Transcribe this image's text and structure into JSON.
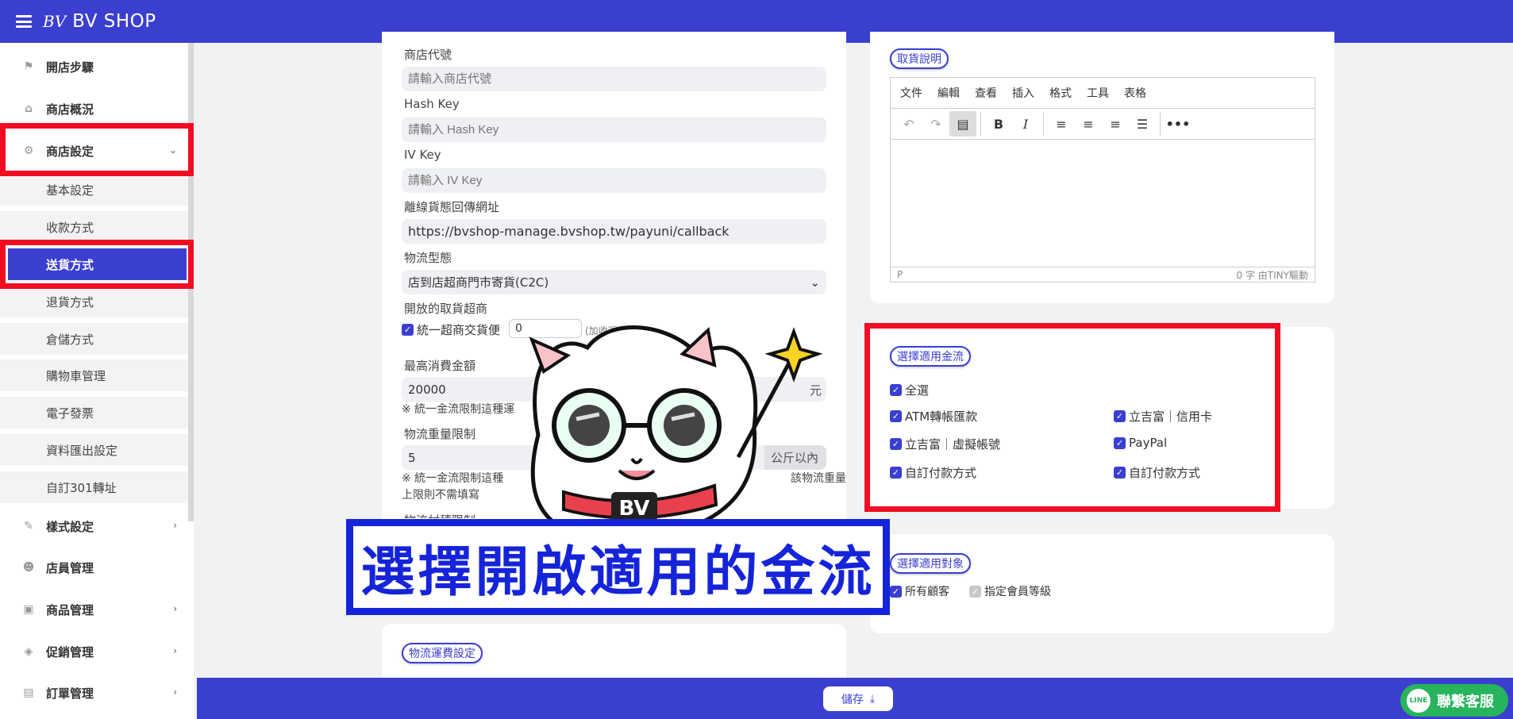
{
  "topbar": {
    "logo_mark": "BV",
    "brand": "BV SHOP"
  },
  "sidebar": {
    "items": [
      {
        "label": "開店步驟",
        "icon": "flag-icon"
      },
      {
        "label": "商店概況",
        "icon": "home-icon"
      },
      {
        "label": "商店設定",
        "icon": "gear-icon",
        "expanded": true
      },
      {
        "label": "樣式設定",
        "icon": "magic-wand-icon"
      },
      {
        "label": "店員管理",
        "icon": "users-icon"
      },
      {
        "label": "商品管理",
        "icon": "box-icon"
      },
      {
        "label": "促銷管理",
        "icon": "tags-icon"
      },
      {
        "label": "訂單管理",
        "icon": "clipboard-icon"
      }
    ],
    "sub_items": [
      {
        "label": "基本設定"
      },
      {
        "label": "收款方式"
      },
      {
        "label": "送貨方式",
        "active": true
      },
      {
        "label": "退貨方式"
      },
      {
        "label": "倉儲方式"
      },
      {
        "label": "購物車管理"
      },
      {
        "label": "電子發票"
      },
      {
        "label": "資料匯出設定"
      },
      {
        "label": "自訂301轉址"
      }
    ]
  },
  "form": {
    "store_code": {
      "label": "商店代號",
      "placeholder": "請輸入商店代號"
    },
    "hash_key": {
      "label": "Hash Key",
      "placeholder": "請輸入 Hash Key"
    },
    "iv_key": {
      "label": "IV Key",
      "placeholder": "請輸入 IV Key"
    },
    "callback_url": {
      "label": "離線貨態回傳網址",
      "value": "https://bvshop-manage.bvshop.tw/payuni/callback"
    },
    "logistics_type": {
      "label": "物流型態",
      "selected": "店到店超商門市寄貨(C2C)"
    },
    "open_stores": {
      "label": "開放的取貨超商",
      "store_name": "統一超商交貨便",
      "fee_value": "0",
      "fee_note": "(加收運費)"
    },
    "max_amount": {
      "label": "最高消費金額",
      "value": "20000",
      "unit": "元",
      "note": "※ 統一金流限制這種運"
    },
    "weight_limit": {
      "label": "物流重量限制",
      "value": "5",
      "unit": "公斤以內",
      "note_a": "※ 統一金流限制這種",
      "note_b": "該物流重量",
      "note_c": "上限則不需填寫"
    },
    "volume_limit": {
      "label": "物流材積限制"
    }
  },
  "shipping_fee": {
    "title": "物流運費設定"
  },
  "pickup": {
    "title": "取貨說明",
    "menu": [
      "文件",
      "編輯",
      "查看",
      "插入",
      "格式",
      "工具",
      "表格"
    ],
    "status_left": "P",
    "status_right": "0 字  由TINY驅動"
  },
  "payment": {
    "title": "選擇適用金流",
    "select_all": "全選",
    "options": [
      {
        "label": "ATM轉帳匯款",
        "checked": true
      },
      {
        "label": "立吉富｜信用卡",
        "checked": true
      },
      {
        "label": "立吉富｜虛擬帳號",
        "checked": true
      },
      {
        "label": "PayPal",
        "checked": true
      },
      {
        "label": "自訂付款方式",
        "checked": true
      },
      {
        "label": "自訂付款方式",
        "checked": true
      }
    ]
  },
  "audience": {
    "title": "選擇適用對象",
    "all_customers": "所有顧客",
    "member_levels": "指定會員等級"
  },
  "overlay": {
    "caption": "選擇開啟適用的金流",
    "mascot_badge": "BV"
  },
  "bottom": {
    "save_label": "儲存",
    "contact_label": "聯繫客服",
    "line_badge": "LINE"
  },
  "colors": {
    "primary": "#3b3fd0",
    "highlight": "#f00d22",
    "caption": "#1524d9",
    "line": "#27b45c"
  }
}
